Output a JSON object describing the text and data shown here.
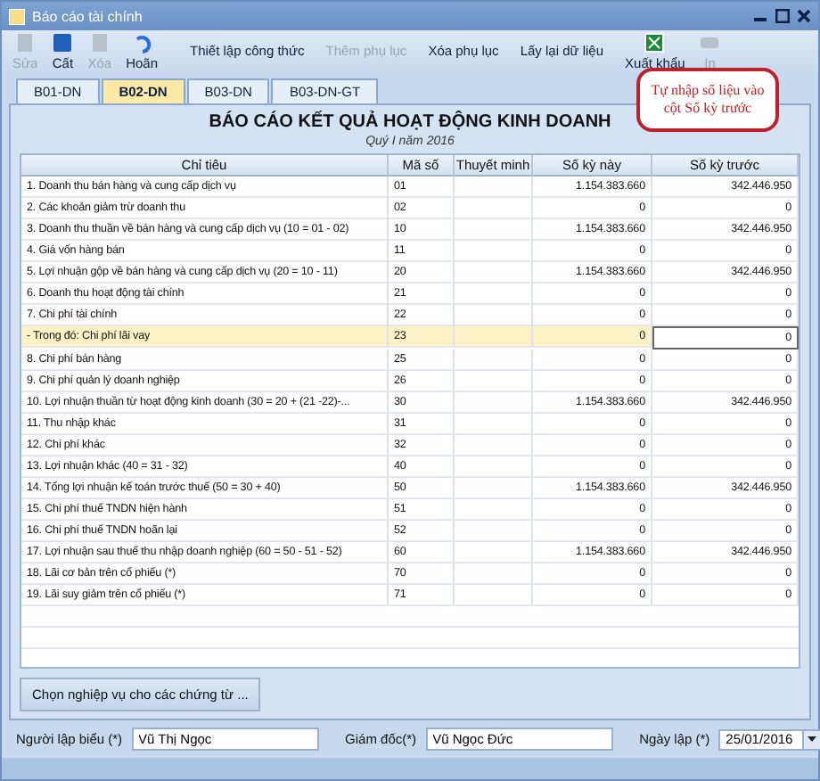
{
  "window": {
    "title": "Báo cáo tài chính"
  },
  "toolbar": [
    {
      "kind": "icon",
      "label": "Sửa",
      "disabled": true
    },
    {
      "kind": "icon",
      "label": "Cất",
      "disabled": false
    },
    {
      "kind": "icon",
      "label": "Xóa",
      "disabled": true
    },
    {
      "kind": "icon",
      "label": "Hoãn",
      "disabled": false
    },
    {
      "kind": "text",
      "label": "Thiết lập công thức",
      "disabled": false
    },
    {
      "kind": "text",
      "label": "Thêm phụ lục",
      "disabled": true
    },
    {
      "kind": "text",
      "label": "Xóa phụ lục",
      "disabled": false
    },
    {
      "kind": "text",
      "label": "Lấy lại dữ liệu",
      "disabled": false
    },
    {
      "kind": "icon",
      "label": "Xuất khẩu",
      "disabled": false
    },
    {
      "kind": "icon",
      "label": "In",
      "disabled": true
    }
  ],
  "tabs": [
    {
      "label": "B01-DN",
      "selected": false
    },
    {
      "label": "B02-DN",
      "selected": true
    },
    {
      "label": "B03-DN",
      "selected": false
    },
    {
      "label": "B03-DN-GT",
      "selected": false
    }
  ],
  "callout": "Tự nhập số liệu vào cột Số kỳ trước",
  "report": {
    "title": "BÁO CÁO KẾT QUẢ HOẠT ĐỘNG KINH DOANH",
    "period": "Quý I năm 2016"
  },
  "table": {
    "columns": [
      "Chỉ tiêu",
      "Mã số",
      "Thuyết minh",
      "Số kỳ này",
      "Số kỳ trước"
    ],
    "rows": [
      {
        "label": "1. Doanh thu bán hàng và cung cấp dịch vụ",
        "code": "01",
        "current": "1.154.383.660",
        "previous": "342.446.950",
        "selected": false
      },
      {
        "label": "2. Các khoản giảm trừ doanh thu",
        "code": "02",
        "current": "0",
        "previous": "0",
        "selected": false
      },
      {
        "label": "3. Doanh thu thuần về bán hàng và cung cấp dịch vụ (10 = 01 - 02)",
        "code": "10",
        "current": "1.154.383.660",
        "previous": "342.446.950",
        "selected": false
      },
      {
        "label": "4. Giá vốn hàng bán",
        "code": "11",
        "current": "0",
        "previous": "0",
        "selected": false
      },
      {
        "label": "5. Lợi nhuận gộp về bán hàng và cung cấp dịch vụ (20 = 10 - 11)",
        "code": "20",
        "current": "1.154.383.660",
        "previous": "342.446.950",
        "selected": false
      },
      {
        "label": "6. Doanh thu hoạt động tài chính",
        "code": "21",
        "current": "0",
        "previous": "0",
        "selected": false
      },
      {
        "label": "7. Chi phí tài chính",
        "code": "22",
        "current": "0",
        "previous": "0",
        "selected": false
      },
      {
        "label": "- Trong đó: Chi phí lãi vay",
        "code": "23",
        "current": "0",
        "previous": "0",
        "selected": true
      },
      {
        "label": "8. Chi phí bán hàng",
        "code": "25",
        "current": "0",
        "previous": "0",
        "selected": false
      },
      {
        "label": "9. Chi phí quản lý doanh nghiệp",
        "code": "26",
        "current": "0",
        "previous": "0",
        "selected": false
      },
      {
        "label": "10. Lợi nhuận thuần từ hoạt động kinh doanh (30 = 20 + (21 -22)-...",
        "code": "30",
        "current": "1.154.383.660",
        "previous": "342.446.950",
        "selected": false
      },
      {
        "label": "11. Thu nhập khác",
        "code": "31",
        "current": "0",
        "previous": "0",
        "selected": false
      },
      {
        "label": "12. Chi phí khác",
        "code": "32",
        "current": "0",
        "previous": "0",
        "selected": false
      },
      {
        "label": "13. Lợi nhuận khác (40 = 31 - 32)",
        "code": "40",
        "current": "0",
        "previous": "0",
        "selected": false
      },
      {
        "label": "14. Tổng lợi nhuận kế toán trước thuế (50 = 30 + 40)",
        "code": "50",
        "current": "1.154.383.660",
        "previous": "342.446.950",
        "selected": false
      },
      {
        "label": "15. Chi phí thuế TNDN hiện hành",
        "code": "51",
        "current": "0",
        "previous": "0",
        "selected": false
      },
      {
        "label": "16. Chi phí thuế TNDN hoãn lại",
        "code": "52",
        "current": "0",
        "previous": "0",
        "selected": false
      },
      {
        "label": "17. Lợi nhuận sau thuế thu nhập doanh nghiệp (60 = 50 - 51 - 52)",
        "code": "60",
        "current": "1.154.383.660",
        "previous": "342.446.950",
        "selected": false
      },
      {
        "label": "18. Lãi cơ bản trên cổ phiếu (*)",
        "code": "70",
        "current": "0",
        "previous": "0",
        "selected": false
      },
      {
        "label": "19. Lãi suy giảm trên cổ phiếu (*)",
        "code": "71",
        "current": "0",
        "previous": "0",
        "selected": false
      }
    ]
  },
  "action_button": "Chọn nghiệp vụ cho các chứng từ ...",
  "footer": [
    {
      "kind": "text",
      "label": "Người lập biểu (*)",
      "value": "Vũ Thị Ngọc"
    },
    {
      "kind": "text",
      "label": "Giám đốc(*)",
      "value": "Vũ Ngọc Đức"
    },
    {
      "kind": "date",
      "label": "Ngày lập (*)",
      "value": "25/01/2016"
    }
  ]
}
